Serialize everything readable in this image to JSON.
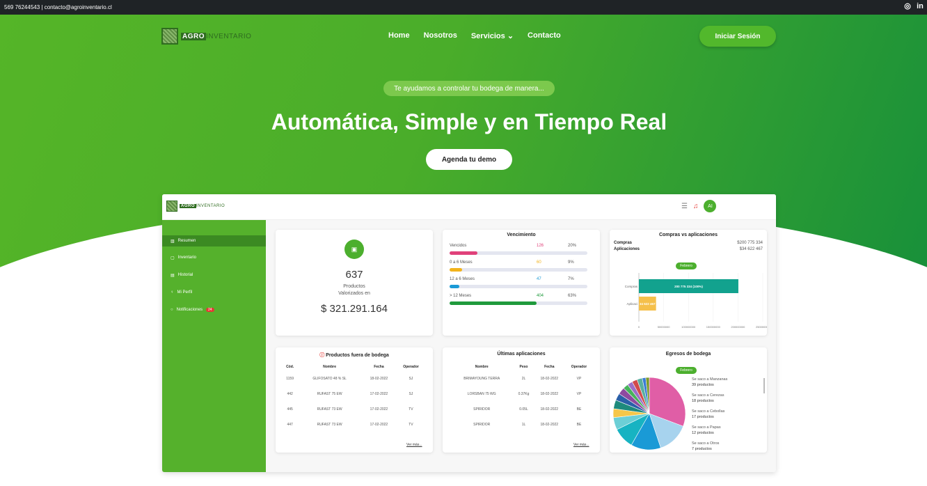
{
  "topbar": {
    "contact": "569 76244543 | contacto@agroinventario.cl",
    "icons": [
      "instagram-icon",
      "linkedin-icon"
    ]
  },
  "brand": {
    "logo_a": "AGRO",
    "logo_b": "INVENTARIO"
  },
  "nav": {
    "items": [
      "Home",
      "Nosotros",
      "Servicios",
      "Contacto"
    ],
    "login": "Iniciar Sesión"
  },
  "hero": {
    "pill": "Te ayudamos a controlar tu bodega de manera...",
    "headline": "Automática, Simple y en Tiempo Real",
    "cta": "Agenda tu demo"
  },
  "dashboard": {
    "avatar": "AI",
    "sidebar": [
      {
        "label": "Resumen"
      },
      {
        "label": "Inventario"
      },
      {
        "label": "Historial"
      },
      {
        "label": "Mi Perfil"
      },
      {
        "label": "Notificaciones",
        "badge": "24"
      }
    ],
    "summary": {
      "count": "637",
      "line1": "Productos",
      "line2": "Valorizados en",
      "value": "$ 321.291.164"
    },
    "vencimiento": {
      "title": "Vencimiento",
      "rows": [
        {
          "label": "Vencidos",
          "count": "126",
          "pct": "20%",
          "fill": 0.2,
          "color": "#e0417a",
          "count_color": "#e0417a"
        },
        {
          "label": "0 a 6 Meses",
          "count": "60",
          "pct": "9%",
          "fill": 0.09,
          "color": "#f2b31b",
          "count_color": "#f2b31b"
        },
        {
          "label": "12 a 6 Meses",
          "count": "47",
          "pct": "7%",
          "fill": 0.07,
          "color": "#1a9ad6",
          "count_color": "#1a9ad6"
        },
        {
          "label": "> 12 Meses",
          "count": "404",
          "pct": "63%",
          "fill": 0.63,
          "color": "#1f9a3c",
          "count_color": "#1f9a3c"
        }
      ]
    },
    "compras": {
      "title": "Compras vs aplicaciones",
      "compras_label": "Compras",
      "compras_value": "$200 775 334",
      "aplic_label": "Aplicaciones",
      "aplic_value": "$34 622 467",
      "month": "Febrero",
      "bars": [
        {
          "name": "Compras",
          "value": 200775334,
          "label": "200 775 334 (100%)",
          "color": "#12a28e"
        },
        {
          "name": "Aplicaci",
          "value": 34622467,
          "label": "34 622 467",
          "color": "#f5c04b"
        }
      ],
      "xticks": [
        "0",
        "50000000",
        "100000000",
        "150000000",
        "200000000",
        "250000000"
      ],
      "xmax": 250000000
    },
    "fuera": {
      "title": "Productos fuera de bodega",
      "headers": [
        "Cód.",
        "Nombre",
        "Fecha",
        "Operador"
      ],
      "rows": [
        [
          "1159",
          "GLIFOSATO 48 % SL",
          "18-02-2022",
          "SJ"
        ],
        [
          "442",
          "RUFAST 75 EW",
          "17-02-2022",
          "SJ"
        ],
        [
          "445",
          "RUFAST 73 EW",
          "17-02-2022",
          "TV"
        ],
        [
          "447",
          "RUFAST 73 EW",
          "17-02-2022",
          "TV"
        ]
      ],
      "more": "Ver más..."
    },
    "aplicaciones": {
      "title": "Últimas aplicaciones",
      "headers": [
        "Nombre",
        "Peso",
        "Fecha",
        "Operador"
      ],
      "rows": [
        [
          "BRIMAYOUNG TERRA",
          "2L",
          "18-02-2022",
          "VP"
        ],
        [
          "LORSBAN 75 WG",
          "0.37Kg",
          "18-02-2022",
          "VP"
        ],
        [
          "SPIRIDOR",
          "0.05L",
          "18-02-2022",
          "BE"
        ],
        [
          "SPIRIDOR",
          "1L",
          "18-02-2022",
          "BE"
        ]
      ],
      "more": "Ver más..."
    },
    "egresos": {
      "title": "Egresos de bodega",
      "month": "Febrero",
      "legend": [
        {
          "text": "Se saco a Manzanas",
          "count": "39 productos"
        },
        {
          "text": "Se saco a Cerezas",
          "count": "18 productos"
        },
        {
          "text": "Se saco a Cebollas",
          "count": "17 productos"
        },
        {
          "text": "Se saco a Papas",
          "count": "12 productos"
        },
        {
          "text": "Se saco a Otros",
          "count": "7 productos"
        }
      ],
      "slices": [
        {
          "value": 39,
          "color": "#e05ea6"
        },
        {
          "value": 18,
          "color": "#a7d3ee"
        },
        {
          "value": 17,
          "color": "#1a9ad6"
        },
        {
          "value": 12,
          "color": "#17b3c2"
        },
        {
          "value": 7,
          "color": "#6ccfd6"
        },
        {
          "value": 5,
          "color": "#f6c749"
        },
        {
          "value": 5,
          "color": "#1e8a7c"
        },
        {
          "value": 4,
          "color": "#2a5fa8"
        },
        {
          "value": 4,
          "color": "#8e4aa0"
        },
        {
          "value": 3,
          "color": "#47b35b"
        },
        {
          "value": 3,
          "color": "#9c6fc7"
        },
        {
          "value": 3,
          "color": "#d24a4a"
        },
        {
          "value": 3,
          "color": "#5ab0a0"
        },
        {
          "value": 2,
          "color": "#3a7bd5"
        },
        {
          "value": 2,
          "color": "#7d9a2b"
        }
      ]
    }
  }
}
